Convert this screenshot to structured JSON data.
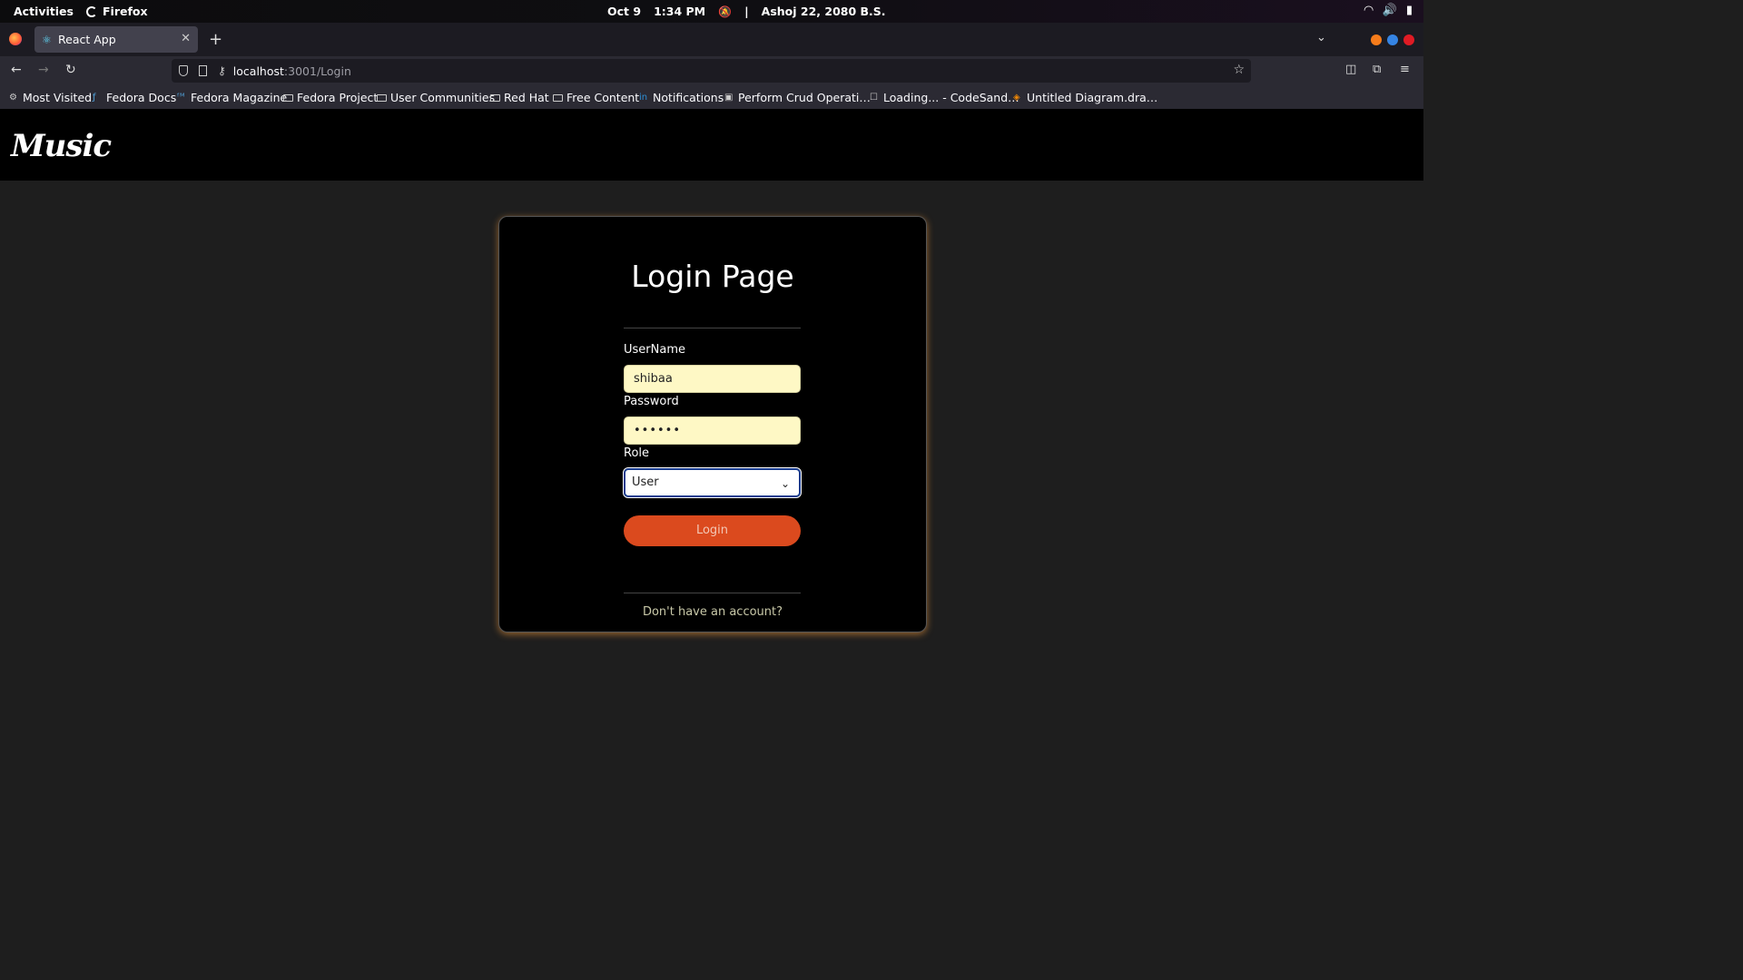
{
  "system_bar": {
    "activities": "Activities",
    "app": "Firefox",
    "date": "Oct 9",
    "time": "1:34 PM",
    "separator": "|",
    "nepali_date": "Ashoj 22, 2080 B.S."
  },
  "browser": {
    "tab_title": "React App",
    "url_host": "localhost",
    "url_path": ":3001/Login",
    "bookmarks": [
      "Most Visited",
      "Fedora Docs",
      "Fedora Magazine",
      "Fedora Project",
      "User Communities",
      "Red Hat",
      "Free Content",
      "Notifications",
      "Perform Crud Operati…",
      "Loading... - CodeSand…",
      "Untitled Diagram.dra…"
    ]
  },
  "app": {
    "logo_text": "Music"
  },
  "login": {
    "title": "Login Page",
    "username_label": "UserName",
    "username_value": "shibaa",
    "password_label": "Password",
    "password_value": "••••••",
    "role_label": "Role",
    "role_value": "User",
    "login_button": "Login",
    "signup_link": "Don't have an account?"
  },
  "colors": {
    "page_bg": "#1e1e1e",
    "card_bg": "#000000",
    "input_bg": "#fef8c5",
    "button_bg": "#db4a1e",
    "card_glow": "#ffa03c"
  }
}
